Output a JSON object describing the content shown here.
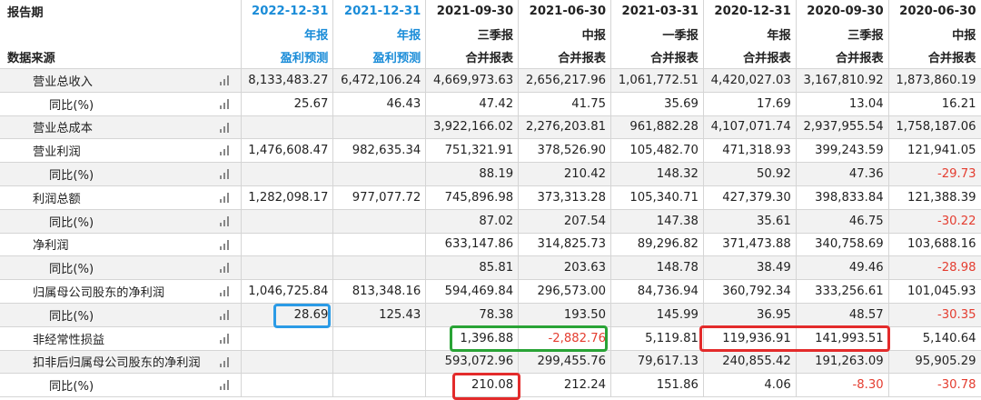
{
  "header": {
    "row1_label": "报告期",
    "row3_label": "数据来源",
    "periods": [
      "2022-12-31",
      "2021-12-31",
      "2021-09-30",
      "2021-06-30",
      "2021-03-31",
      "2020-12-31",
      "2020-09-30",
      "2020-06-30"
    ],
    "report_types": [
      "年报",
      "年报",
      "三季报",
      "中报",
      "一季报",
      "年报",
      "三季报",
      "中报"
    ],
    "sources": [
      "盈利预测",
      "盈利预测",
      "合并报表",
      "合并报表",
      "合并报表",
      "合并报表",
      "合并报表",
      "合并报表"
    ]
  },
  "rows": [
    {
      "label": "营业总收入",
      "sub": false,
      "values": [
        "8,133,483.27",
        "6,472,106.24",
        "4,669,973.63",
        "2,656,217.96",
        "1,061,772.51",
        "4,420,027.03",
        "3,167,810.92",
        "1,873,860.19"
      ]
    },
    {
      "label": "同比(%)",
      "sub": true,
      "values": [
        "25.67",
        "46.43",
        "47.42",
        "41.75",
        "35.69",
        "17.69",
        "13.04",
        "16.21"
      ]
    },
    {
      "label": "营业总成本",
      "sub": false,
      "values": [
        "",
        "",
        "3,922,166.02",
        "2,276,203.81",
        "961,882.28",
        "4,107,071.74",
        "2,937,955.54",
        "1,758,187.06"
      ]
    },
    {
      "label": "营业利润",
      "sub": false,
      "values": [
        "1,476,608.47",
        "982,635.34",
        "751,321.91",
        "378,526.90",
        "105,482.70",
        "471,318.93",
        "399,243.59",
        "121,941.05"
      ]
    },
    {
      "label": "同比(%)",
      "sub": true,
      "values": [
        "",
        "",
        "88.19",
        "210.42",
        "148.32",
        "50.92",
        "47.36",
        "-29.73"
      ]
    },
    {
      "label": "利润总额",
      "sub": false,
      "values": [
        "1,282,098.17",
        "977,077.72",
        "745,896.98",
        "373,313.28",
        "105,340.71",
        "427,379.30",
        "398,833.84",
        "121,388.39"
      ]
    },
    {
      "label": "同比(%)",
      "sub": true,
      "values": [
        "",
        "",
        "87.02",
        "207.54",
        "147.38",
        "35.61",
        "46.75",
        "-30.22"
      ]
    },
    {
      "label": "净利润",
      "sub": false,
      "values": [
        "",
        "",
        "633,147.86",
        "314,825.73",
        "89,296.82",
        "371,473.88",
        "340,758.69",
        "103,688.16"
      ]
    },
    {
      "label": "同比(%)",
      "sub": true,
      "values": [
        "",
        "",
        "85.81",
        "203.63",
        "148.78",
        "38.49",
        "49.46",
        "-28.98"
      ]
    },
    {
      "label": "归属母公司股东的净利润",
      "sub": false,
      "values": [
        "1,046,725.84",
        "813,348.16",
        "594,469.84",
        "296,573.00",
        "84,736.94",
        "360,792.34",
        "333,256.61",
        "101,045.93"
      ]
    },
    {
      "label": "同比(%)",
      "sub": true,
      "values": [
        "28.69",
        "125.43",
        "78.38",
        "193.50",
        "145.99",
        "36.95",
        "48.57",
        "-30.35"
      ]
    },
    {
      "label": "非经常性损益",
      "sub": false,
      "values": [
        "",
        "",
        "1,396.88",
        "-2,882.76",
        "5,119.81",
        "119,936.91",
        "141,993.51",
        "5,140.64"
      ]
    },
    {
      "label": "扣非后归属母公司股东的净利润",
      "sub": false,
      "values": [
        "",
        "",
        "593,072.96",
        "299,455.76",
        "79,617.13",
        "240,855.42",
        "191,263.09",
        "95,905.29"
      ]
    },
    {
      "label": "同比(%)",
      "sub": true,
      "values": [
        "",
        "",
        "210.08",
        "212.24",
        "151.86",
        "4.06",
        "-8.30",
        "-30.78"
      ]
    }
  ],
  "colors": {
    "forecast_header": "#1a8cd8",
    "negative": "#e43d30",
    "highlight_blue": "#2b9be6",
    "highlight_green": "#29a336",
    "highlight_red": "#e32b2b"
  },
  "icons": {
    "row_chart": "bar-chart-icon"
  }
}
